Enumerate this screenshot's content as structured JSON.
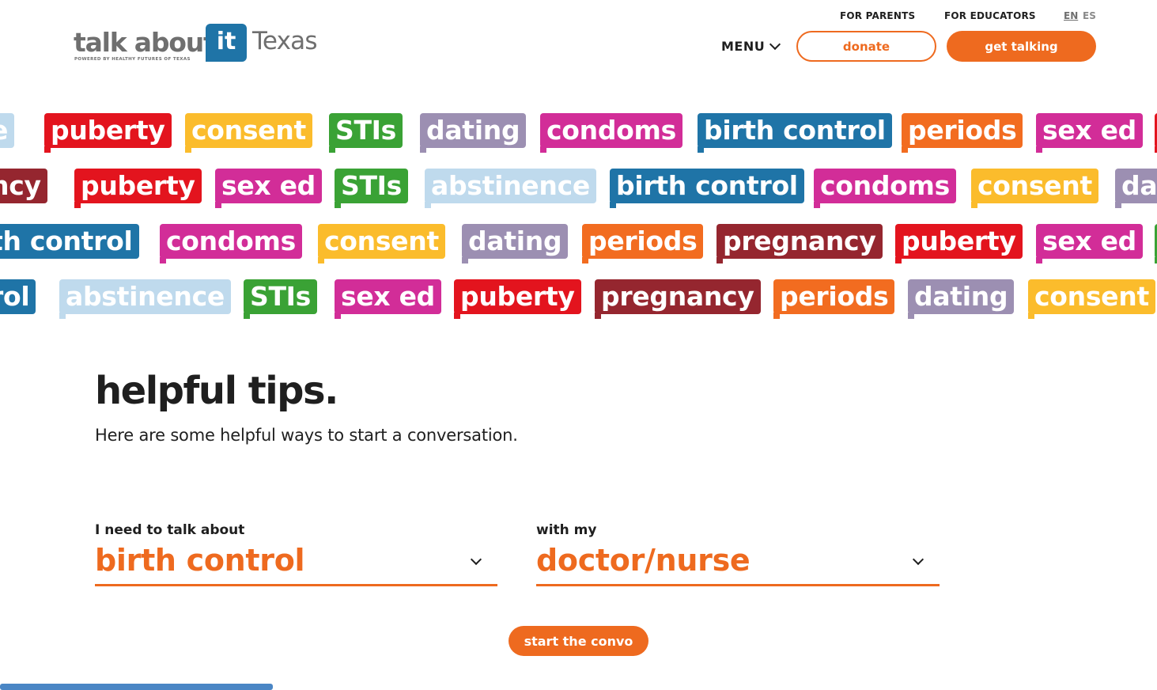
{
  "header": {
    "logo": {
      "text_main": "talk about",
      "text_it": "it",
      "text_state": "Texas",
      "tagline": "POWERED BY HEALTHY FUTURES OF TEXAS"
    },
    "top_links": [
      "FOR PARENTS",
      "FOR EDUCATORS"
    ],
    "languages": [
      "EN",
      "ES"
    ],
    "active_language": "EN",
    "menu_label": "MENU",
    "donate_label": "donate",
    "get_talking_label": "get talking"
  },
  "colors": {
    "accent": "#ee6a1f",
    "puberty": "#e3141e",
    "consent": "#fbbc2c",
    "stis": "#3aa235",
    "dating": "#9c8fb2",
    "condoms": "#d22d98",
    "birth_control": "#1f74a7",
    "periods": "#f26c20",
    "sex_ed": "#d22d98",
    "abstinence": "#bfdaed",
    "pregnancy": "#95262f"
  },
  "tag_rows": [
    [
      {
        "label": "e",
        "color": "#bfdaed"
      },
      {
        "label": "puberty",
        "color": "#e3141e"
      },
      {
        "label": "consent",
        "color": "#fbbc2c"
      },
      {
        "label": "STIs",
        "color": "#3aa235"
      },
      {
        "label": "dating",
        "color": "#9c8fb2"
      },
      {
        "label": "condoms",
        "color": "#d22d98"
      },
      {
        "label": "birth control",
        "color": "#1f74a7"
      },
      {
        "label": "periods",
        "color": "#f26c20"
      },
      {
        "label": "sex ed",
        "color": "#d22d98"
      },
      {
        "label": "",
        "color": "#e3141e"
      }
    ],
    [
      {
        "label": "ncy",
        "color": "#95262f"
      },
      {
        "label": "puberty",
        "color": "#e3141e"
      },
      {
        "label": "sex ed",
        "color": "#d22d98"
      },
      {
        "label": "STIs",
        "color": "#3aa235"
      },
      {
        "label": "abstinence",
        "color": "#bfdaed"
      },
      {
        "label": "birth control",
        "color": "#1f74a7"
      },
      {
        "label": "condoms",
        "color": "#d22d98"
      },
      {
        "label": "consent",
        "color": "#fbbc2c"
      },
      {
        "label": "dat",
        "color": "#9c8fb2"
      }
    ],
    [
      {
        "label": "th control",
        "color": "#1f74a7"
      },
      {
        "label": "condoms",
        "color": "#d22d98"
      },
      {
        "label": "consent",
        "color": "#fbbc2c"
      },
      {
        "label": "dating",
        "color": "#9c8fb2"
      },
      {
        "label": "periods",
        "color": "#f26c20"
      },
      {
        "label": "pregnancy",
        "color": "#95262f"
      },
      {
        "label": "puberty",
        "color": "#e3141e"
      },
      {
        "label": "sex ed",
        "color": "#d22d98"
      },
      {
        "label": "",
        "color": "#3aa235"
      }
    ],
    [
      {
        "label": "rol",
        "color": "#1f74a7"
      },
      {
        "label": "abstinence",
        "color": "#bfdaed"
      },
      {
        "label": "STIs",
        "color": "#3aa235"
      },
      {
        "label": "sex ed",
        "color": "#d22d98"
      },
      {
        "label": "puberty",
        "color": "#e3141e"
      },
      {
        "label": "pregnancy",
        "color": "#95262f"
      },
      {
        "label": "periods",
        "color": "#f26c20"
      },
      {
        "label": "dating",
        "color": "#9c8fb2"
      },
      {
        "label": "consent",
        "color": "#fbbc2c"
      }
    ]
  ],
  "tips": {
    "title": "helpful tips.",
    "subtitle": "Here are some helpful ways to start a conversation.",
    "topic_label": "I need to talk about",
    "topic_value": "birth control",
    "with_label": "with my",
    "with_value": "doctor/nurse",
    "start_label": "start the convo"
  }
}
